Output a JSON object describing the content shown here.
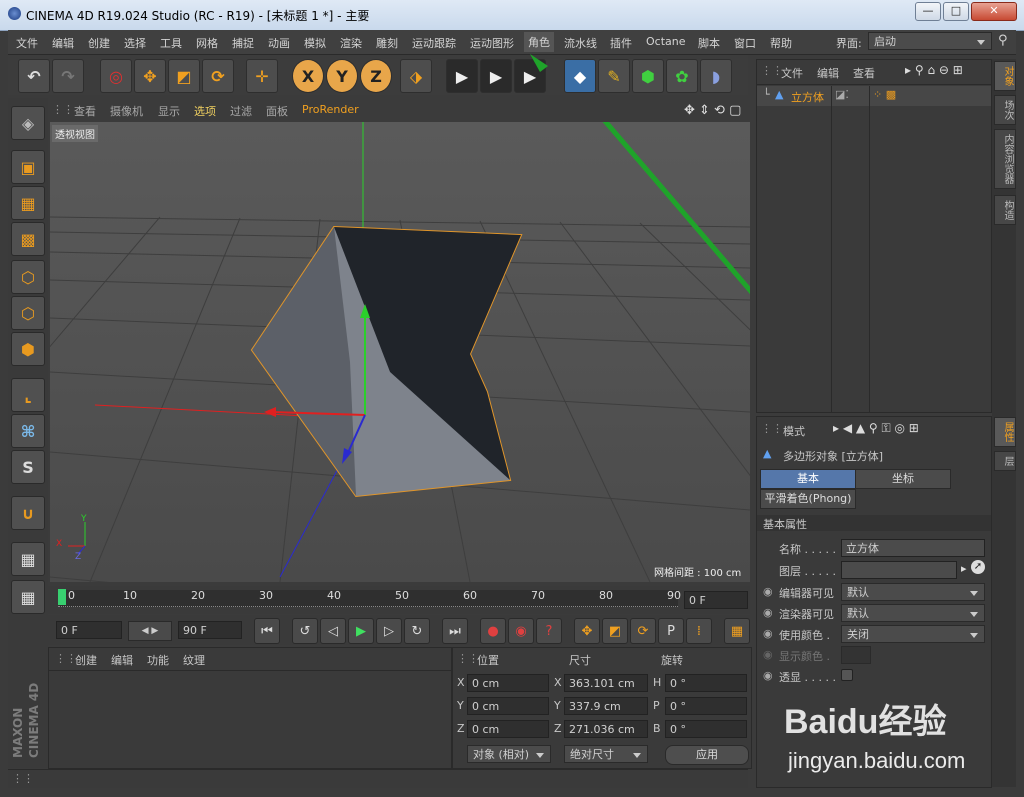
{
  "window": {
    "title": "CINEMA 4D R19.024 Studio (RC - R19) - [未标题 1 *] - 主要",
    "min": "—",
    "max": "□",
    "close": "✕"
  },
  "menubar": {
    "items": [
      "文件",
      "编辑",
      "创建",
      "选择",
      "工具",
      "网格",
      "捕捉",
      "动画",
      "模拟",
      "渲染",
      "雕刻",
      "运动跟踪",
      "运动图形",
      "角色",
      "流水线",
      "插件",
      "Octane",
      "脚本",
      "窗口",
      "帮助"
    ],
    "layout_label": "界面:",
    "layout_value": "启动"
  },
  "viewport_menu": {
    "items": [
      "查看",
      "摄像机",
      "显示",
      "选项",
      "过滤",
      "面板",
      "ProRender"
    ]
  },
  "viewport": {
    "name": "透视视图",
    "grid_spacing": "网格间距 : 100 cm",
    "axis_y": "Y",
    "axis_x": "X",
    "axis_z": "Z"
  },
  "timeline": {
    "ticks": [
      "0",
      "10",
      "20",
      "30",
      "40",
      "50",
      "60",
      "70",
      "80",
      "90"
    ],
    "current_frame": "0 F"
  },
  "transport": {
    "start": "0 F",
    "end": "90 F"
  },
  "material_panel": {
    "tabs": [
      "创建",
      "编辑",
      "功能",
      "纹理"
    ]
  },
  "coord_panel": {
    "headers": [
      "位置",
      "尺寸",
      "旋转"
    ],
    "rows": [
      {
        "pl": "X",
        "pv": "0 cm",
        "sl": "X",
        "sv": "363.101 cm",
        "rl": "H",
        "rv": "0 °"
      },
      {
        "pl": "Y",
        "pv": "0 cm",
        "sl": "Y",
        "sv": "337.9 cm",
        "rl": "P",
        "rv": "0 °"
      },
      {
        "pl": "Z",
        "pv": "0 cm",
        "sl": "Z",
        "sv": "271.036 cm",
        "rl": "B",
        "rv": "0 °"
      }
    ],
    "mode": "对象 (相对)",
    "size_mode": "绝对尺寸",
    "apply": "应用"
  },
  "object_panel": {
    "menu": [
      "文件",
      "编辑",
      "查看"
    ],
    "object_name": "立方体"
  },
  "right_tabs": {
    "top": [
      "对象",
      "场次",
      "内容浏览器",
      "构造"
    ],
    "bottom": [
      "属性",
      "层"
    ]
  },
  "attr_panel": {
    "mode": "模式",
    "object_title": "多边形对象 [立方体]",
    "tabs": [
      "基本",
      "坐标"
    ],
    "tab_phong": "平滑着色(Phong)",
    "section": "基本属性",
    "name_label": "名称 . . . . .",
    "name_value": "立方体",
    "layer_label": "图层 . . . . .",
    "editor_visible_label": "编辑器可见",
    "editor_visible_value": "默认",
    "render_visible_label": "渲染器可见",
    "render_visible_value": "默认",
    "use_color_label": "使用颜色 .",
    "use_color_value": "关闭",
    "display_color_label": "显示颜色 .",
    "xray_label": "透显 . . . . ."
  },
  "brand": {
    "maxon": "MAXON",
    "cinema": "CINEMA 4D"
  },
  "watermark": {
    "brand": "Baidu经验",
    "url": "jingyan.baidu.com"
  },
  "colors": {
    "accent": "#f0a020",
    "selection_orange": "#e0952a",
    "axis_green": "#2bd02b",
    "axis_red": "#e02020",
    "axis_blue": "#2a2ad0"
  }
}
